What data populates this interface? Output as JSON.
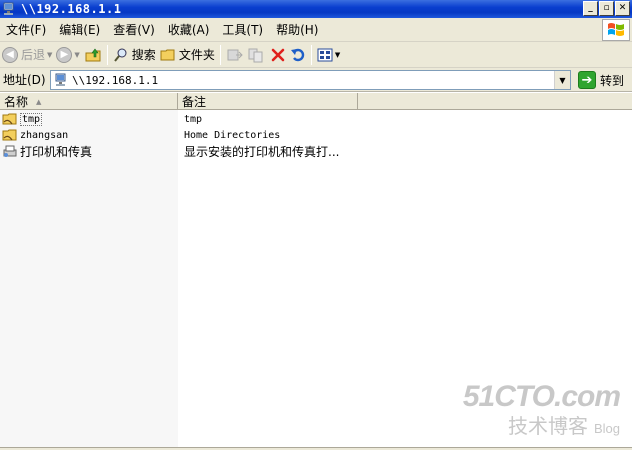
{
  "window": {
    "title": "\\\\192.168.1.1",
    "title_icon": "network-computer-icon",
    "controls": {
      "minimize": "_",
      "maximize": "▫",
      "close": "✕"
    }
  },
  "menubar": {
    "items": [
      {
        "label": "文件(F)"
      },
      {
        "label": "编辑(E)"
      },
      {
        "label": "查看(V)"
      },
      {
        "label": "收藏(A)"
      },
      {
        "label": "工具(T)"
      },
      {
        "label": "帮助(H)"
      }
    ]
  },
  "toolbar": {
    "back_label": "后退",
    "search_label": "搜索",
    "folders_label": "文件夹"
  },
  "address": {
    "label": "地址(D)",
    "value": "\\\\192.168.1.1",
    "go_label": "转到"
  },
  "list": {
    "columns": {
      "name": "名称",
      "comment": "备注"
    },
    "rows": [
      {
        "name": "tmp",
        "comment": "tmp",
        "icon": "shared-folder-icon"
      },
      {
        "name": "zhangsan",
        "comment": "Home Directories",
        "icon": "shared-folder-icon"
      },
      {
        "name": "打印机和传真",
        "comment": "显示安装的打印机和传真打...",
        "icon": "printer-fax-icon"
      }
    ]
  },
  "watermark": {
    "line1": "51CTO.com",
    "line2": "技术博客",
    "blog": "Blog"
  },
  "colors": {
    "titlebar": "#0a3fcf",
    "chrome": "#ece9d8",
    "go_green": "#2fa52f",
    "delete_red": "#e0201b"
  }
}
